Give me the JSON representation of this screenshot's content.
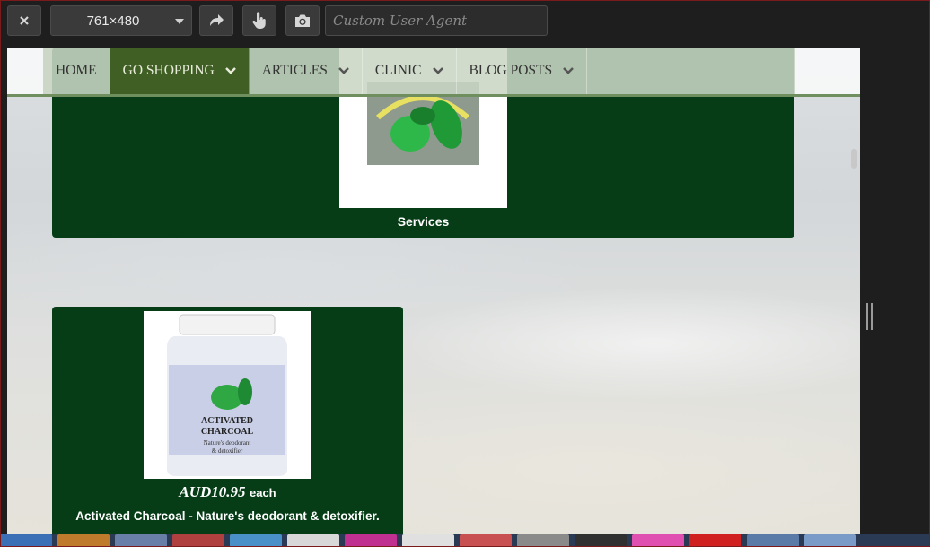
{
  "toolbar": {
    "close_icon": "close-icon",
    "size_value": "761×480",
    "rotate_icon": "rotate-icon",
    "touch_icon": "touch-icon",
    "screenshot_icon": "camera-icon",
    "ua_placeholder": "Custom User Agent"
  },
  "nav": {
    "items": [
      {
        "label": "HOME"
      },
      {
        "label": "GO SHOPPING"
      },
      {
        "label": "ARTICLES"
      },
      {
        "label": "CLINIC"
      },
      {
        "label": "BLOG POSTS"
      }
    ]
  },
  "cards": {
    "services": {
      "label": "Services"
    },
    "product": {
      "jar_label_line1": "ACTIVATED",
      "jar_label_line2": "CHARCOAL",
      "jar_sub1": "Nature's deodorant",
      "jar_sub2": "& detoxifier",
      "price": "AUD10.95",
      "unit": "each",
      "description": "Activated Charcoal - Nature's deodorant & detoxifier."
    }
  },
  "colors": {
    "card_green": "#063d17",
    "nav_active": "#3f5f25",
    "toolbar_bg": "#1e1e1e"
  },
  "taskbar": {
    "icons": [
      "ie-icon",
      "folder-icon",
      "media-icon",
      "app-icon",
      "browser-icon",
      "app-icon",
      "app-icon",
      "word-icon",
      "app-icon",
      "app-icon",
      "app-icon",
      "app-icon",
      "app-icon",
      "app-icon",
      "app-icon",
      "app-icon"
    ]
  }
}
